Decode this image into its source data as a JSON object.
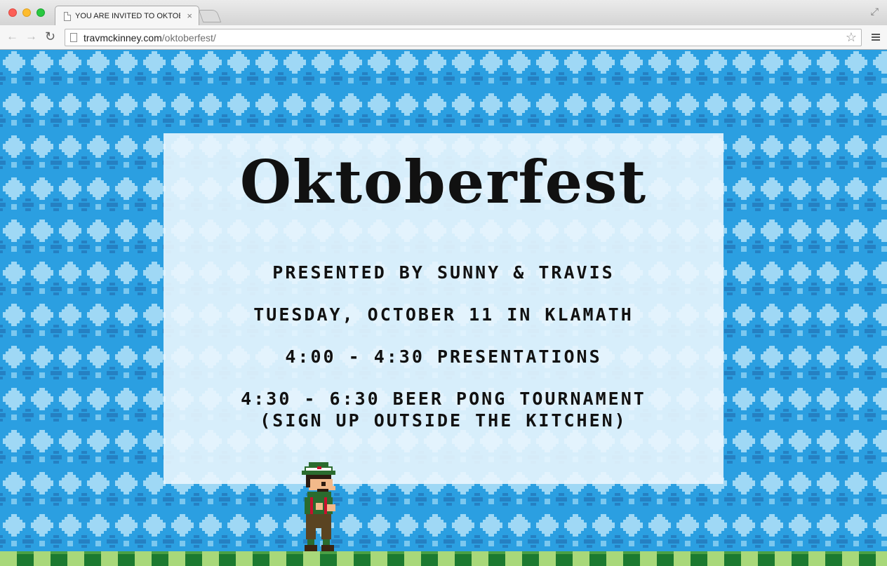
{
  "browser": {
    "tab_title": "YOU ARE INVITED TO OKTOBERFEST",
    "tab_close": "×",
    "url_host": "travmckinney.com",
    "url_path": "/oktoberfest/"
  },
  "page": {
    "logo": "Oktoberfest",
    "presented_by": "Presented by Sunny & Travis",
    "date_line": "Tuesday, October 11 in Klamath",
    "schedule_1": "4:00 - 4:30 Presentations",
    "schedule_2": "4:30 - 6:30 Beer Pong Tournament",
    "schedule_2_note": "(Sign up outside the kitchen)"
  },
  "colors": {
    "background_blue": "#2b9fe1",
    "diamond_light": "#9fd8f5",
    "diamond_dark": "#2580c2",
    "card": "#eaf6fe",
    "ground_light": "#a8d87a",
    "ground_dark": "#1c7a30"
  },
  "icons": {
    "back": "arrow-left-icon",
    "forward": "arrow-right-icon",
    "reload": "reload-icon",
    "bookmark": "star-icon",
    "menu": "hamburger-menu-icon",
    "fullscreen": "fullscreen-icon"
  }
}
